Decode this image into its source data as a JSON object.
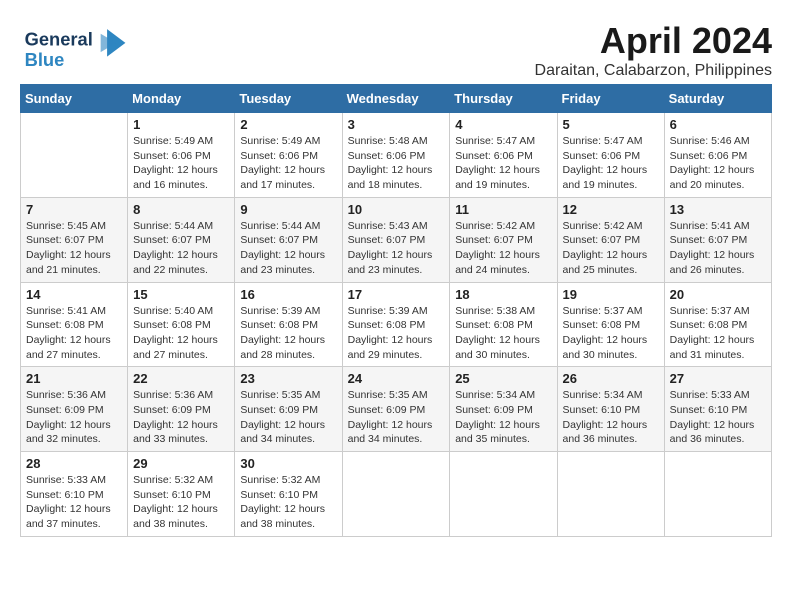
{
  "header": {
    "logo_general": "General",
    "logo_blue": "Blue",
    "month": "April 2024",
    "location": "Daraitan, Calabarzon, Philippines"
  },
  "weekdays": [
    "Sunday",
    "Monday",
    "Tuesday",
    "Wednesday",
    "Thursday",
    "Friday",
    "Saturday"
  ],
  "weeks": [
    [
      {
        "day": "",
        "info": ""
      },
      {
        "day": "1",
        "info": "Sunrise: 5:49 AM\nSunset: 6:06 PM\nDaylight: 12 hours\nand 16 minutes."
      },
      {
        "day": "2",
        "info": "Sunrise: 5:49 AM\nSunset: 6:06 PM\nDaylight: 12 hours\nand 17 minutes."
      },
      {
        "day": "3",
        "info": "Sunrise: 5:48 AM\nSunset: 6:06 PM\nDaylight: 12 hours\nand 18 minutes."
      },
      {
        "day": "4",
        "info": "Sunrise: 5:47 AM\nSunset: 6:06 PM\nDaylight: 12 hours\nand 19 minutes."
      },
      {
        "day": "5",
        "info": "Sunrise: 5:47 AM\nSunset: 6:06 PM\nDaylight: 12 hours\nand 19 minutes."
      },
      {
        "day": "6",
        "info": "Sunrise: 5:46 AM\nSunset: 6:06 PM\nDaylight: 12 hours\nand 20 minutes."
      }
    ],
    [
      {
        "day": "7",
        "info": "Sunrise: 5:45 AM\nSunset: 6:07 PM\nDaylight: 12 hours\nand 21 minutes."
      },
      {
        "day": "8",
        "info": "Sunrise: 5:44 AM\nSunset: 6:07 PM\nDaylight: 12 hours\nand 22 minutes."
      },
      {
        "day": "9",
        "info": "Sunrise: 5:44 AM\nSunset: 6:07 PM\nDaylight: 12 hours\nand 23 minutes."
      },
      {
        "day": "10",
        "info": "Sunrise: 5:43 AM\nSunset: 6:07 PM\nDaylight: 12 hours\nand 23 minutes."
      },
      {
        "day": "11",
        "info": "Sunrise: 5:42 AM\nSunset: 6:07 PM\nDaylight: 12 hours\nand 24 minutes."
      },
      {
        "day": "12",
        "info": "Sunrise: 5:42 AM\nSunset: 6:07 PM\nDaylight: 12 hours\nand 25 minutes."
      },
      {
        "day": "13",
        "info": "Sunrise: 5:41 AM\nSunset: 6:07 PM\nDaylight: 12 hours\nand 26 minutes."
      }
    ],
    [
      {
        "day": "14",
        "info": "Sunrise: 5:41 AM\nSunset: 6:08 PM\nDaylight: 12 hours\nand 27 minutes."
      },
      {
        "day": "15",
        "info": "Sunrise: 5:40 AM\nSunset: 6:08 PM\nDaylight: 12 hours\nand 27 minutes."
      },
      {
        "day": "16",
        "info": "Sunrise: 5:39 AM\nSunset: 6:08 PM\nDaylight: 12 hours\nand 28 minutes."
      },
      {
        "day": "17",
        "info": "Sunrise: 5:39 AM\nSunset: 6:08 PM\nDaylight: 12 hours\nand 29 minutes."
      },
      {
        "day": "18",
        "info": "Sunrise: 5:38 AM\nSunset: 6:08 PM\nDaylight: 12 hours\nand 30 minutes."
      },
      {
        "day": "19",
        "info": "Sunrise: 5:37 AM\nSunset: 6:08 PM\nDaylight: 12 hours\nand 30 minutes."
      },
      {
        "day": "20",
        "info": "Sunrise: 5:37 AM\nSunset: 6:08 PM\nDaylight: 12 hours\nand 31 minutes."
      }
    ],
    [
      {
        "day": "21",
        "info": "Sunrise: 5:36 AM\nSunset: 6:09 PM\nDaylight: 12 hours\nand 32 minutes."
      },
      {
        "day": "22",
        "info": "Sunrise: 5:36 AM\nSunset: 6:09 PM\nDaylight: 12 hours\nand 33 minutes."
      },
      {
        "day": "23",
        "info": "Sunrise: 5:35 AM\nSunset: 6:09 PM\nDaylight: 12 hours\nand 34 minutes."
      },
      {
        "day": "24",
        "info": "Sunrise: 5:35 AM\nSunset: 6:09 PM\nDaylight: 12 hours\nand 34 minutes."
      },
      {
        "day": "25",
        "info": "Sunrise: 5:34 AM\nSunset: 6:09 PM\nDaylight: 12 hours\nand 35 minutes."
      },
      {
        "day": "26",
        "info": "Sunrise: 5:34 AM\nSunset: 6:10 PM\nDaylight: 12 hours\nand 36 minutes."
      },
      {
        "day": "27",
        "info": "Sunrise: 5:33 AM\nSunset: 6:10 PM\nDaylight: 12 hours\nand 36 minutes."
      }
    ],
    [
      {
        "day": "28",
        "info": "Sunrise: 5:33 AM\nSunset: 6:10 PM\nDaylight: 12 hours\nand 37 minutes."
      },
      {
        "day": "29",
        "info": "Sunrise: 5:32 AM\nSunset: 6:10 PM\nDaylight: 12 hours\nand 38 minutes."
      },
      {
        "day": "30",
        "info": "Sunrise: 5:32 AM\nSunset: 6:10 PM\nDaylight: 12 hours\nand 38 minutes."
      },
      {
        "day": "",
        "info": ""
      },
      {
        "day": "",
        "info": ""
      },
      {
        "day": "",
        "info": ""
      },
      {
        "day": "",
        "info": ""
      }
    ]
  ]
}
